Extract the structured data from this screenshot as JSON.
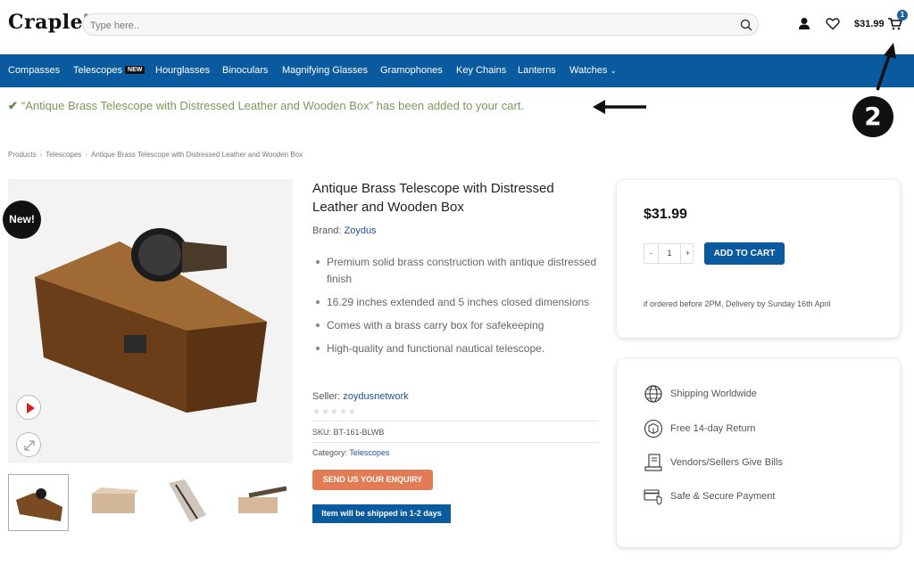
{
  "header": {
    "logo": "Craple",
    "logo_mark": "®",
    "search_placeholder": "Type here..",
    "cart_total": "$31.99",
    "cart_count": "1"
  },
  "nav": {
    "items": [
      {
        "label": "Compasses"
      },
      {
        "label": "Telescopes",
        "badge": "NEW"
      },
      {
        "label": "Hourglasses"
      },
      {
        "label": "Binoculars"
      },
      {
        "label": "Magnifying Glasses"
      },
      {
        "label": "Gramophones"
      },
      {
        "label": "Key Chains"
      },
      {
        "label": "Lanterns"
      },
      {
        "label": "Watches"
      }
    ]
  },
  "notice": {
    "text": "“Antique Brass Telescope with Distressed Leather and Wooden Box” has been added to your cart."
  },
  "annotation": {
    "step_number": "2"
  },
  "breadcrumb": [
    "Products",
    "Telescopes",
    "Antique Brass Telescope with Distressed Leather and Wooden Box"
  ],
  "product": {
    "new_label": "New!",
    "title": "Antique Brass Telescope with Distressed Leather and Wooden Box",
    "brand_label": "Brand:",
    "brand": "Zoydus",
    "features": [
      "Premium solid brass construction with antique distressed finish",
      "16.29 inches extended and 5 inches closed dimensions",
      "Comes with a brass carry box for safekeeping",
      "High-quality and functional nautical telescope."
    ],
    "seller_label": "Seller:",
    "seller": "zoydusnetwork",
    "stars": "★★★★★",
    "rating": 0,
    "sku": "SKU: BT-161-BLWB",
    "category_label": "Category:",
    "category": "Telescopes",
    "enquiry_button": "SEND US YOUR ENQUIRY",
    "ship_note": "Item will be shipped in 1-2 days"
  },
  "buybox": {
    "price": "$31.99",
    "qty_minus": "-",
    "qty_value": "1",
    "qty_plus": "+",
    "add_to_cart": "ADD TO CART",
    "delivery": "if ordered before 2PM, Delivery by Sunday 16th April"
  },
  "info": [
    {
      "icon": "globe-icon",
      "label": "Shipping Worldwide"
    },
    {
      "icon": "return-box-icon",
      "label": "Free 14-day Return"
    },
    {
      "icon": "bill-icon",
      "label": "Vendors/Sellers Give Bills"
    },
    {
      "icon": "secure-card-icon",
      "label": "Safe & Secure Payment"
    }
  ],
  "colors": {
    "nav_blue": "#0a5aa0",
    "notice_green": "#7a9a5a",
    "enquiry_orange": "#e37b55",
    "link_blue": "#1e4f9a"
  }
}
